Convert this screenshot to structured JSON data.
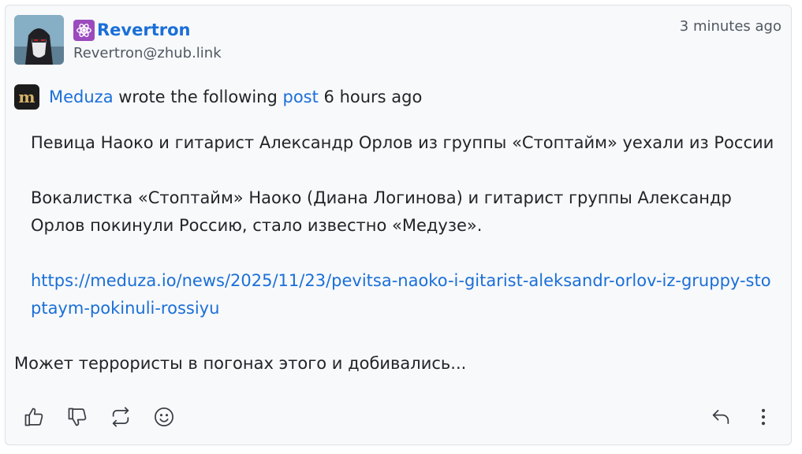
{
  "post": {
    "author_name": "Revertron",
    "author_handle": "Revertron@zhub.link",
    "timestamp": "3 minutes ago",
    "author_icon": "atom-icon",
    "boost": {
      "source_name": "Meduza",
      "middle_text": " wrote the following ",
      "post_link": "post",
      "time": " 6 hours ago",
      "logo_letter": "m"
    },
    "quoted": {
      "title": "Певица Наоко и гитарист Александр Орлов из группы «Стоптайм» уехали из России",
      "body": "Вокалистка «Стоптайм» Наоко (Диана Логинова) и гитарист группы Александр Орлов покинули Россию, стало известно «Медузе».",
      "url": "https://meduza.io/news/2025/11/23/pevitsa-naoko-i-gitarist-aleksandr-orlov-iz-gruppy-stoptaym-pokinuli-rossiyu"
    },
    "comment": "Может террористы в погонах этого и добивались..."
  },
  "actions": {
    "like_icon": "thumbs-up-icon",
    "dislike_icon": "thumbs-down-icon",
    "boost_icon": "repeat-icon",
    "react_icon": "smiley-icon",
    "reply_icon": "reply-icon",
    "more_icon": "more-vertical-icon"
  },
  "colors": {
    "accent": "#1a6fd8",
    "card_bg": "#f8f9fb",
    "border": "#dde1e6",
    "text": "#212529",
    "muted": "#505860"
  }
}
